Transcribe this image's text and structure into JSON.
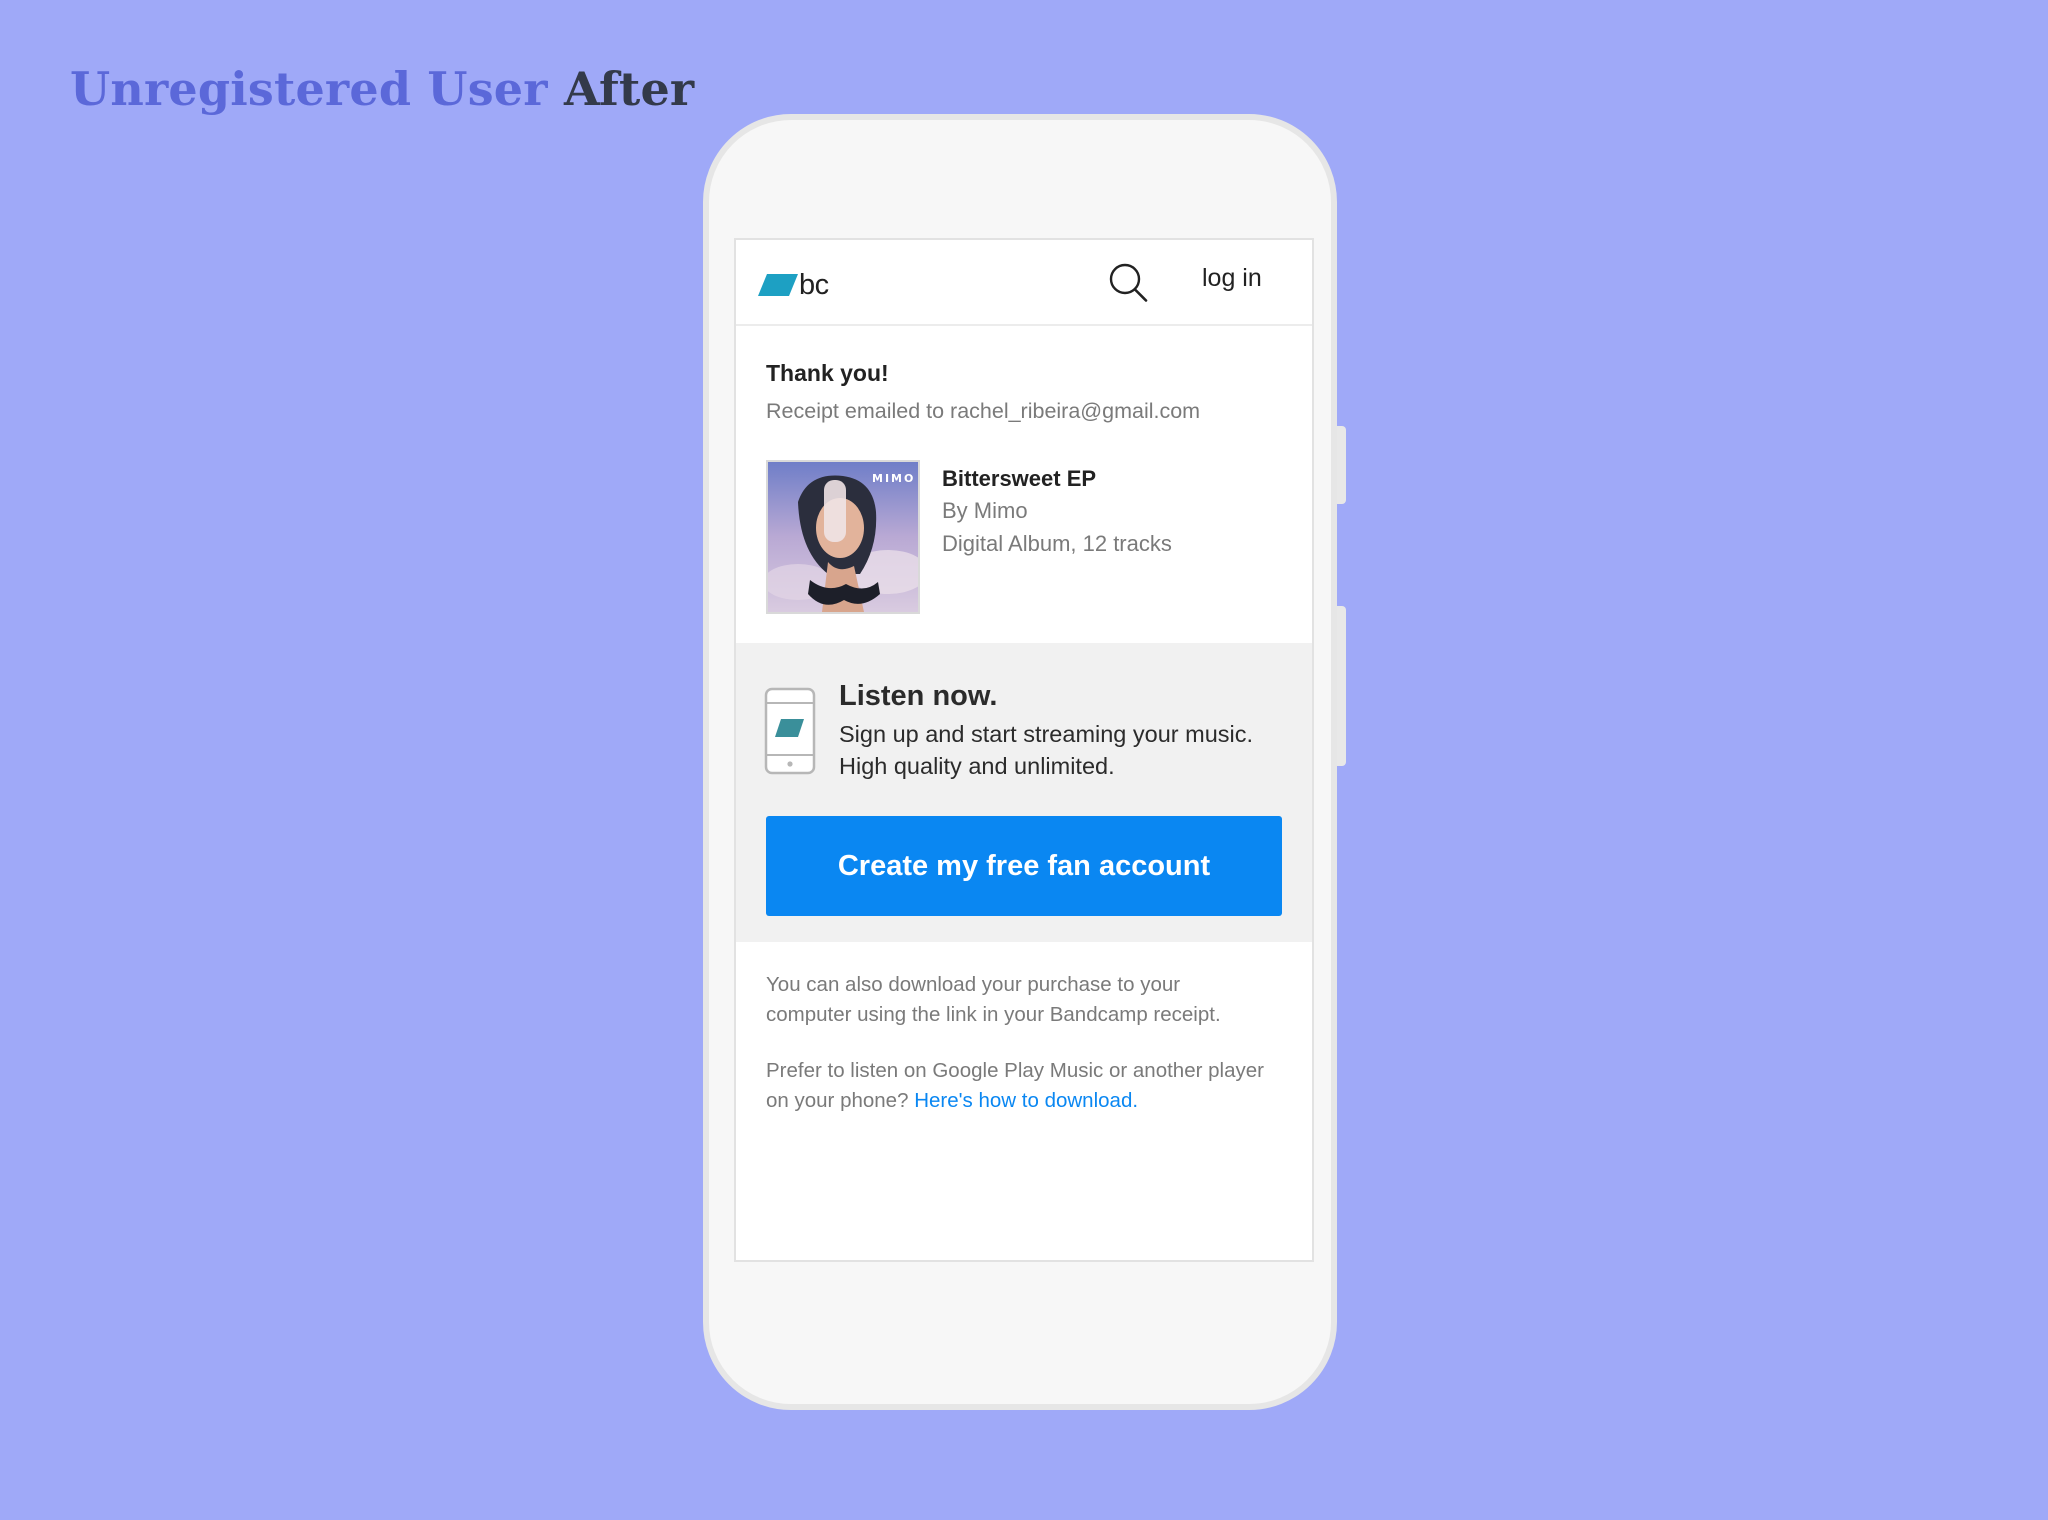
{
  "heading": {
    "highlight": "Unregistered User",
    "rest": "After"
  },
  "header": {
    "logo_text": "bc",
    "login_label": "log in"
  },
  "receipt": {
    "title": "Thank you!",
    "emailed_text": "Receipt emailed to rachel_ribeira@gmail.com"
  },
  "album": {
    "title": "Bittersweet EP",
    "artist": "By Mimo",
    "format": "Digital Album, 12 tracks",
    "cover_text": "MIMO"
  },
  "listen": {
    "title": "Listen now.",
    "desc_line1": "Sign up and start streaming your music.",
    "desc_line2": "High quality and unlimited.",
    "cta_label": "Create my free fan account"
  },
  "notes": {
    "download_line1": "You can also download your purchase to your",
    "download_line2": "computer using the link in your Bandcamp receipt.",
    "player_line1": "Prefer to listen on Google Play Music or another player",
    "player_line2_prefix": "on your phone?",
    "how_link": "Here's how to download",
    "player_line2_suffix": "."
  },
  "colors": {
    "background": "#9fa9f8",
    "heading_highlight": "#5b68d9",
    "accent_blue": "#0a87f2",
    "logo_teal": "#1da0c3"
  },
  "icons": [
    "bandcamp-logo-icon",
    "search-icon",
    "phone-icon"
  ]
}
